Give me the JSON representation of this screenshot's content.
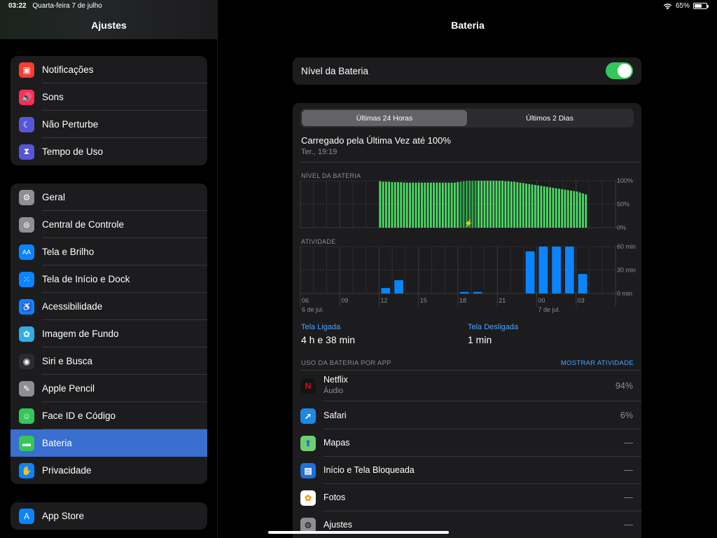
{
  "status": {
    "time": "03:22",
    "date": "Quarta-feira 7 de julho",
    "battery_pct": "65%",
    "battery_level": 0.65
  },
  "sidebar": {
    "title": "Ajustes",
    "groups": [
      [
        {
          "label": "Notificações",
          "icon": "notifications-icon",
          "color": "#ff3b30"
        },
        {
          "label": "Sons",
          "icon": "speaker-icon",
          "color": "#ff2d55"
        },
        {
          "label": "Não Perturbe",
          "icon": "moon-icon",
          "color": "#5856d6"
        },
        {
          "label": "Tempo de Uso",
          "icon": "hourglass-icon",
          "color": "#5856d6"
        }
      ],
      [
        {
          "label": "Geral",
          "icon": "gear-icon",
          "color": "#8e8e93"
        },
        {
          "label": "Central de Controle",
          "icon": "toggles-icon",
          "color": "#8e8e93"
        },
        {
          "label": "Tela e Brilho",
          "icon": "text-size-icon",
          "color": "#0a84ff"
        },
        {
          "label": "Tela de Início e Dock",
          "icon": "grid-icon",
          "color": "#0a84ff"
        },
        {
          "label": "Acessibilidade",
          "icon": "accessibility-icon",
          "color": "#0a84ff"
        },
        {
          "label": "Imagem de Fundo",
          "icon": "flower-icon",
          "color": "#32ade6"
        },
        {
          "label": "Siri e Busca",
          "icon": "siri-icon",
          "color": "#2c2c2e"
        },
        {
          "label": "Apple Pencil",
          "icon": "pencil-icon",
          "color": "#8e8e93"
        },
        {
          "label": "Face ID e Código",
          "icon": "face-id-icon",
          "color": "#34c759"
        },
        {
          "label": "Bateria",
          "icon": "battery-icon",
          "color": "#34c759"
        },
        {
          "label": "Privacidade",
          "icon": "hand-icon",
          "color": "#0a84ff"
        }
      ],
      [
        {
          "label": "App Store",
          "icon": "app-store-icon",
          "color": "#0a84ff"
        }
      ]
    ],
    "selected": "Bateria"
  },
  "main": {
    "title": "Bateria",
    "battery_level_label": "Nível da Bateria",
    "battery_level_on": true,
    "tabs": [
      "Últimas 24 Horas",
      "Últimos 2 Dias"
    ],
    "charged_title": "Carregado pela Última Vez até 100%",
    "charged_time": "Ter., 19:19",
    "screen_on_label": "Tela Ligada",
    "screen_on_value": "4 h e 38 min",
    "screen_off_label": "Tela Desligada",
    "screen_off_value": "1 min",
    "usage_header": "USO DA BATERIA POR APP",
    "show_activity": "MOSTRAR ATIVIDADE",
    "apps": [
      {
        "name": "Netflix",
        "sub": "Áudio",
        "pct": "94%",
        "icon": "netflix-icon",
        "bg": "#141414",
        "glyph": "N",
        "fg": "#e50914"
      },
      {
        "name": "Safari",
        "sub": "",
        "pct": "6%",
        "icon": "safari-icon",
        "bg": "#1e88e5",
        "glyph": "➚",
        "fg": "#ffffff"
      },
      {
        "name": "Mapas",
        "sub": "",
        "pct": "—",
        "icon": "maps-icon",
        "bg": "#6fcf6f",
        "glyph": "⬆",
        "fg": "#1e6fd9"
      },
      {
        "name": "Início e Tela Bloqueada",
        "sub": "",
        "pct": "—",
        "icon": "home-lock-icon",
        "bg": "#1e6fd9",
        "glyph": "▤",
        "fg": "#ffffff"
      },
      {
        "name": "Fotos",
        "sub": "",
        "pct": "—",
        "icon": "photos-icon",
        "bg": "#ffffff",
        "glyph": "✿",
        "fg": "#ff9500"
      },
      {
        "name": "Ajustes",
        "sub": "",
        "pct": "—",
        "icon": "gear-icon",
        "bg": "#8e8e93",
        "glyph": "⚙",
        "fg": "#2c2c2e"
      }
    ]
  },
  "chart_data": [
    {
      "type": "bar",
      "title": "NÍVEL DA BATERIA",
      "y_ticks": [
        "100%",
        "50%",
        "0%"
      ],
      "ylim": [
        0,
        100
      ],
      "x_ticks": [
        "06",
        "09",
        "12",
        "15",
        "18",
        "21",
        "00",
        "03"
      ],
      "x_sub_labels": [
        "6 de jul.",
        "7 de jul."
      ],
      "unit_hours": 24,
      "start_hour": 6,
      "bar_start_hour": 12,
      "bar_end_hour": 3.9,
      "charging_start_hour": 18,
      "charging_end_hour": 19.3,
      "values": [
        99,
        98,
        98,
        98,
        97,
        97,
        97,
        97,
        96,
        96,
        96,
        96,
        96,
        96,
        96,
        96,
        96,
        96,
        96,
        96,
        96,
        96,
        96,
        96,
        96,
        96,
        97,
        98,
        99,
        100,
        100,
        100,
        100,
        100,
        100,
        100,
        100,
        100,
        100,
        100,
        100,
        100,
        99,
        99,
        98,
        98,
        97,
        96,
        95,
        94,
        93,
        92,
        91,
        90,
        89,
        88,
        87,
        86,
        85,
        84,
        83,
        82,
        81,
        80,
        79,
        78,
        77,
        75,
        73,
        71
      ]
    },
    {
      "type": "bar",
      "title": "ATIVIDADE",
      "y_ticks": [
        "60 min",
        "30 min",
        "0 min"
      ],
      "ylim": [
        0,
        60
      ],
      "x_ticks": [
        "06",
        "09",
        "12",
        "15",
        "18",
        "21",
        "00",
        "03"
      ],
      "x_sub_labels": [
        "6 de jul.",
        "7 de jul."
      ],
      "hours": [
        6,
        7,
        8,
        9,
        10,
        11,
        12,
        13,
        14,
        15,
        16,
        17,
        18,
        19,
        20,
        21,
        22,
        23,
        0,
        1,
        2,
        3,
        4,
        5
      ],
      "values": [
        0,
        0,
        0,
        0,
        0,
        0,
        7,
        17,
        0,
        0,
        0,
        0,
        2,
        2,
        0,
        0,
        0,
        54,
        60,
        60,
        60,
        25,
        0,
        0
      ]
    }
  ]
}
